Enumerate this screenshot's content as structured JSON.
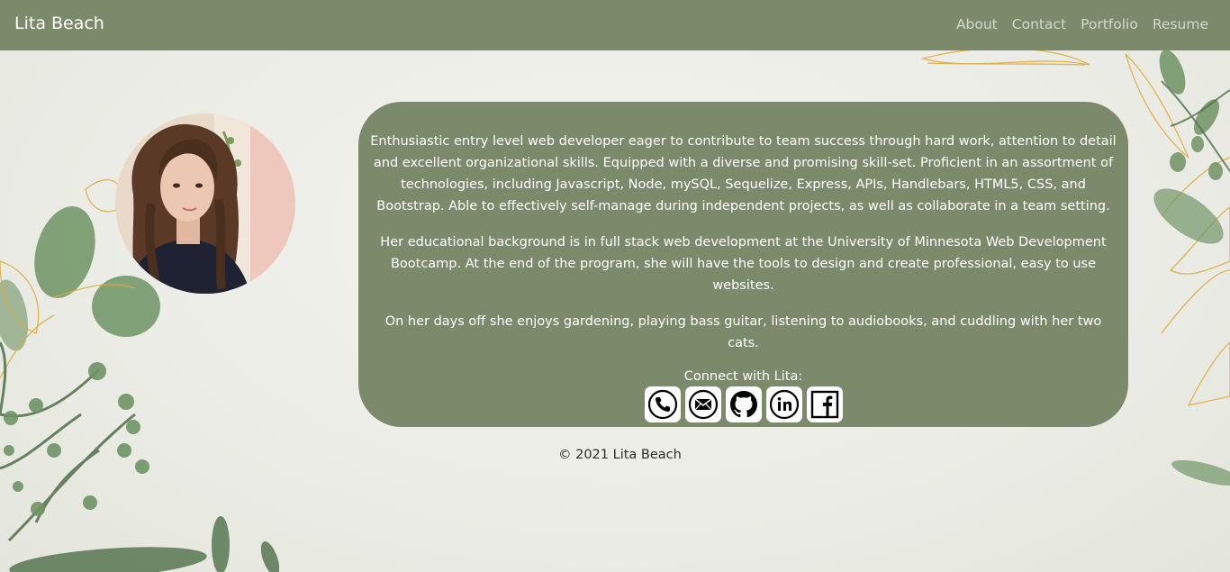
{
  "navbar": {
    "brand": "Lita Beach",
    "links": [
      "About",
      "Contact",
      "Portfolio",
      "Resume"
    ]
  },
  "about": {
    "paragraphs": [
      "Enthusiastic entry level web developer eager to contribute to team success through hard work, attention to detail and excellent organizational skills. Equipped with a diverse and promising skill-set. Proficient in an assortment of technologies, including Javascript, Node, mySQL, Sequelize, Express, APIs, Handlebars, HTML5, CSS, and Bootstrap. Able to effectively self-manage during independent projects, as well as collaborate in a team setting.",
      "Her educational background is in full stack web development at the University of Minnesota Web Development Bootcamp. At the end of the program, she will have the tools to design and create professional, easy to use websites.",
      "On her days off she enjoys gardening, playing bass guitar, listening to audiobooks, and cuddling with her two cats."
    ],
    "connect_label": "Connect with Lita:",
    "socials": [
      {
        "icon": "phone-icon"
      },
      {
        "icon": "email-icon"
      },
      {
        "icon": "github-icon"
      },
      {
        "icon": "linkedin-icon"
      },
      {
        "icon": "facebook-icon"
      }
    ]
  },
  "footer": {
    "copyright": "© 2021 Lita Beach"
  },
  "colors": {
    "navbar_bg": "#7b8a6b",
    "card_bg": "#7b8a6b",
    "nav_link": "#d3d8cc",
    "leaf_green": "#6f9465",
    "gold_line": "#e0a93a"
  }
}
